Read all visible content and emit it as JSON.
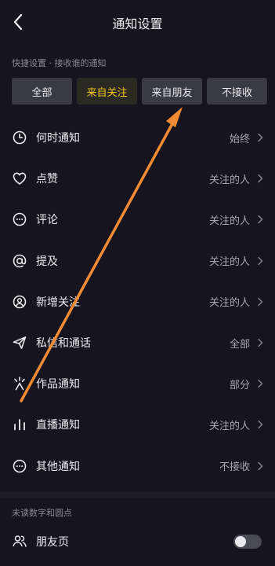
{
  "header": {
    "title": "通知设置",
    "back_icon": "chevron-left-icon"
  },
  "quick": {
    "label": "快捷设置 · 接收谁的通知",
    "options": [
      "全部",
      "来自关注",
      "来自朋友",
      "不接收"
    ],
    "selected": "来自关注",
    "accent": "#f1c21b"
  },
  "items": [
    {
      "icon": "clock-icon",
      "label": "何时通知",
      "value": "始终"
    },
    {
      "icon": "heart-icon",
      "label": "点赞",
      "value": "关注的人"
    },
    {
      "icon": "comment-icon",
      "label": "评论",
      "value": "关注的人"
    },
    {
      "icon": "at-icon",
      "label": "提及",
      "value": "关注的人"
    },
    {
      "icon": "user-add-icon",
      "label": "新增关注",
      "value": "关注的人"
    },
    {
      "icon": "send-icon",
      "label": "私信和通话",
      "value": "全部"
    },
    {
      "icon": "spark-icon",
      "label": "作品通知",
      "value": "部分"
    },
    {
      "icon": "live-bars-icon",
      "label": "直播通知",
      "value": "关注的人"
    },
    {
      "icon": "more-circle-icon",
      "label": "其他通知",
      "value": "不接收"
    }
  ],
  "badge_section": {
    "label": "未读数字和圆点"
  },
  "friends": {
    "icon": "friends-icon",
    "label": "朋友页",
    "enabled": false
  },
  "annotation": {
    "color": "#f28c34"
  }
}
